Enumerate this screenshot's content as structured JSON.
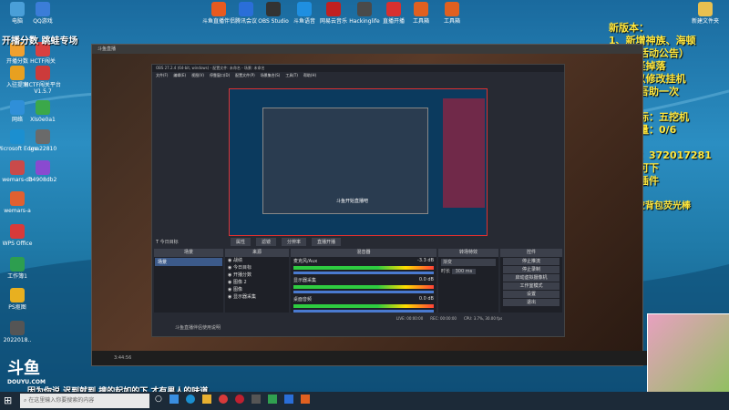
{
  "desktop_icons": [
    {
      "label": "电脑",
      "color": "#4a9fd8"
    },
    {
      "label": "QQ游戏",
      "color": "#3b7dd8"
    },
    {
      "label": "开播分数",
      "color": "#f0a030"
    },
    {
      "label": "HCTF闯关",
      "color": "#d94040"
    },
    {
      "label": "入驻提案",
      "color": "#e8a020"
    },
    {
      "label": "HCTF闯关平台V1.5.7",
      "color": "#cc3b3b"
    },
    {
      "label": "网络",
      "color": "#2f8fd8"
    },
    {
      "label": "Xls0e0a1",
      "color": "#3ba84a"
    },
    {
      "label": "Microsoft Edge",
      "color": "#1b8fd0"
    },
    {
      "label": "una22810",
      "color": "#6a6a6a"
    },
    {
      "label": "wemars-db",
      "color": "#c94a4a"
    },
    {
      "label": "34908db2",
      "color": "#8a4ad0"
    },
    {
      "label": "wemars-a",
      "color": "#e06030"
    },
    {
      "label": "WPS Office",
      "color": "#d83a3a"
    },
    {
      "label": "工作簿1",
      "color": "#2d9e4f"
    },
    {
      "label": "PS抠图",
      "color": "#e8b020"
    },
    {
      "label": "2022018..",
      "color": "#555555"
    }
  ],
  "top_icons": [
    {
      "label": "斗鱼直播伴侣",
      "color": "#e85a20"
    },
    {
      "label": "腾讯会议",
      "color": "#2a6ed8"
    },
    {
      "label": "OBS Studio",
      "color": "#333333"
    },
    {
      "label": "斗鱼语音",
      "color": "#1f8fe0"
    },
    {
      "label": "网易云音乐",
      "color": "#c02020"
    },
    {
      "label": "Hackinglife",
      "color": "#4a4a4a"
    },
    {
      "label": "直播开播",
      "color": "#d83030"
    },
    {
      "label": "工具箱",
      "color": "#e06020"
    },
    {
      "label": "工具箱",
      "color": "#e06020"
    },
    {
      "label": "新建文件夹",
      "color": "#e8c050"
    }
  ],
  "overlay": {
    "line1": "新版本：",
    "line2": "1、新增神族、海顿",
    "line3": "机制（活动公告）",
    "line4": "2、小怪掉落",
    "line5": "3、可以修改挂机",
    "line6": "办卡送吾助一次",
    "goal": "今日目标：五挖机",
    "count": "挖机数量：0/6",
    "group": "水友群：372017281",
    "file": "群文件可下",
    "plugin": "载拔线插件",
    "note": "记得清空背包荧光棒",
    "left_top": "开播分数",
    "left_top2": "跳蛙专场",
    "bottom": "因为你说 迟到就到 搜的起如的下 才有男人的味道",
    "douyu": "斗鱼",
    "douyu_sub": "DOUYU.COM",
    "id": "933"
  },
  "outer_window": {
    "title": "斗鱼直播"
  },
  "obs": {
    "title": "OBS 27.2.4 (64-bit, windows) - 配置文件: 未命名 - 场景: 未命名",
    "menu": [
      "文件(F)",
      "编辑(E)",
      "视图(V)",
      "停靠窗口(D)",
      "配置文件(P)",
      "场景集合(S)",
      "工具(T)",
      "帮助(H)"
    ],
    "source_label": "今日目标",
    "tabs": [
      "属性",
      "滤镜",
      "分辨率",
      "直播开播"
    ],
    "panels": {
      "scenes": "场景",
      "sources": "来源",
      "mixer": "混音器",
      "transitions": "转场特效",
      "controls": "控件"
    },
    "scenes": [
      "场景"
    ],
    "sources": [
      "战绩",
      "今日目标",
      "开播分数",
      "图像 2",
      "图像",
      "显示器采集"
    ],
    "mixer": [
      {
        "name": "麦克风/Aux",
        "db": "-3.3 dB"
      },
      {
        "name": "显示器采集",
        "db": "0.0 dB"
      },
      {
        "name": "桌面音频",
        "db": "0.0 dB"
      }
    ],
    "transition": {
      "name": "渐变",
      "duration_label": "时长",
      "duration": "300 ms"
    },
    "controls": [
      "停止推流",
      "停止录制",
      "启动虚拟摄像机",
      "工作室模式",
      "设置",
      "退出"
    ],
    "status": [
      "LIVE: 00:00:00",
      "REC: 00:00:00",
      "CPU: 3.7%, 30.00 fps"
    ],
    "nested_caption": "斗鱼开始直播吧"
  },
  "outer_status": "3:44:56",
  "outer_bottom": "斗鱼直播伴侣使用说明",
  "taskbar": {
    "search_placeholder": "在这里输入你要搜索的内容"
  }
}
